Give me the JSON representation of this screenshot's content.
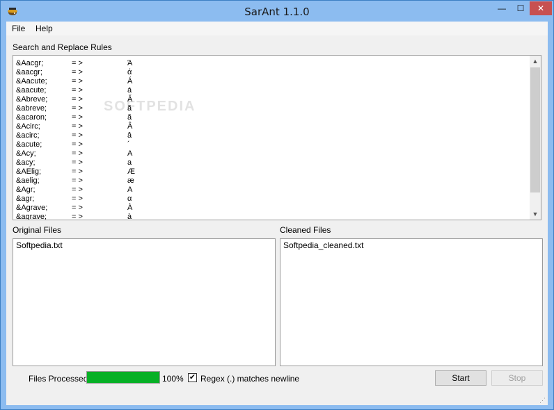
{
  "window": {
    "title": "SarAnt 1.1.0",
    "minimize": "—",
    "maximize": "☐",
    "close": "✕"
  },
  "menu": {
    "items": [
      {
        "label": "File"
      },
      {
        "label": "Help"
      }
    ]
  },
  "rules": {
    "label": "Search and Replace Rules",
    "rows": [
      {
        "entity": "&Aacgr;",
        "arrow": "= >",
        "char": "Ά"
      },
      {
        "entity": "&aacgr;",
        "arrow": "= >",
        "char": "ά"
      },
      {
        "entity": "&Aacute;",
        "arrow": "= >",
        "char": "Á"
      },
      {
        "entity": "&aacute;",
        "arrow": "= >",
        "char": "á"
      },
      {
        "entity": "&Abreve;",
        "arrow": "= >",
        "char": "Ă"
      },
      {
        "entity": "&abreve;",
        "arrow": "= >",
        "char": "ă"
      },
      {
        "entity": "&acaron;",
        "arrow": "= >",
        "char": "ǎ"
      },
      {
        "entity": "&Acirc;",
        "arrow": "= >",
        "char": "Â"
      },
      {
        "entity": "&acirc;",
        "arrow": "= >",
        "char": "â"
      },
      {
        "entity": "&acute;",
        "arrow": "= >",
        "char": "´"
      },
      {
        "entity": "&Acy;",
        "arrow": "= >",
        "char": "А"
      },
      {
        "entity": "&acy;",
        "arrow": "= >",
        "char": "а"
      },
      {
        "entity": "&AElig;",
        "arrow": "= >",
        "char": "Æ"
      },
      {
        "entity": "&aelig;",
        "arrow": "= >",
        "char": "æ"
      },
      {
        "entity": "&Agr;",
        "arrow": "= >",
        "char": "Α"
      },
      {
        "entity": "&agr;",
        "arrow": "= >",
        "char": "α"
      },
      {
        "entity": "&Agrave;",
        "arrow": "= >",
        "char": "À"
      },
      {
        "entity": "&agrave;",
        "arrow": "= >",
        "char": "à"
      }
    ],
    "watermark": "SOFTPEDIA"
  },
  "original": {
    "label": "Original Files",
    "files": [
      "Softpedia.txt"
    ]
  },
  "cleaned": {
    "label": "Cleaned Files",
    "files": [
      "Softpedia_cleaned.txt"
    ]
  },
  "status": {
    "files_processed_label": "Files Processed",
    "progress": 1.0,
    "progress_text": "100%",
    "regex_label": "Regex (.) matches newline",
    "regex_checked": true,
    "checkmark": "✔"
  },
  "buttons": {
    "start": "Start",
    "stop": "Stop"
  },
  "colors": {
    "progress": "#06b025",
    "close": "#c75050"
  }
}
